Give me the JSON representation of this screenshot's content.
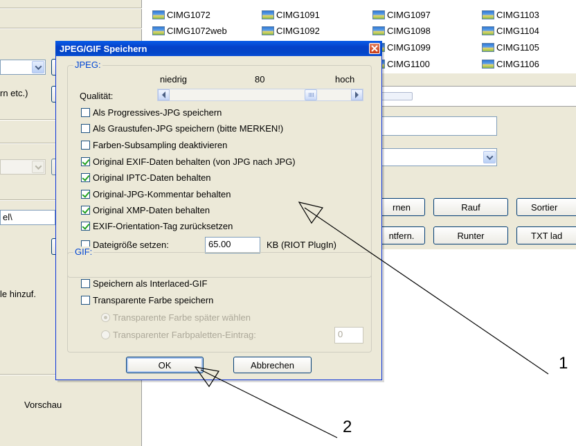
{
  "background": {
    "left_panel": {
      "label_partial_1": "rn etc.)",
      "path_partial": "el\\",
      "label_partial_2": "le hinzuf.",
      "preview_label": "Vorschau"
    },
    "files": [
      [
        "CIMG1072",
        "CIMG1091",
        "CIMG1097",
        "CIMG1103"
      ],
      [
        "CIMG1072web",
        "CIMG1092",
        "CIMG1098",
        "CIMG1104"
      ],
      [
        "",
        "",
        "CIMG1099",
        "CIMG1105"
      ],
      [
        "",
        "",
        "CIMG1100",
        "CIMG1106"
      ]
    ],
    "buttons": {
      "remove_partial": "rnen",
      "up": "Rauf",
      "sort_partial": "Sortier",
      "remove2_partial": "ntfern.",
      "down": "Runter",
      "txt_partial": "TXT lad"
    }
  },
  "dialog": {
    "title": "JPEG/GIF Speichern",
    "jpeg": {
      "legend": "JPEG:",
      "low_label": "niedrig",
      "value": "80",
      "high_label": "hoch",
      "quality_label": "Qualität:",
      "quality_fraction": 0.8,
      "options": [
        {
          "label": "Als Progressives-JPG speichern",
          "checked": false
        },
        {
          "label": "Als Graustufen-JPG speichern (bitte MERKEN!)",
          "checked": false
        },
        {
          "label": "Farben-Subsampling deaktivieren",
          "checked": false
        },
        {
          "label": "Original EXIF-Daten behalten (von JPG nach JPG)",
          "checked": true
        },
        {
          "label": "Original IPTC-Daten behalten",
          "checked": true
        },
        {
          "label": "Original-JPG-Kommentar behalten",
          "checked": true
        },
        {
          "label": "Original XMP-Daten behalten",
          "checked": true
        },
        {
          "label": "EXIF-Orientation-Tag zurücksetzen",
          "checked": true
        }
      ],
      "filesize": {
        "label": "Dateigröße setzen:",
        "checked": false,
        "value": "65.00",
        "unit": "KB (RIOT PlugIn)"
      }
    },
    "gif": {
      "legend": "GIF:",
      "interlaced_label": "Speichern als Interlaced-GIF",
      "transparent_label": "Transparente Farbe speichern",
      "radio_later": "Transparente Farbe später wählen",
      "radio_palette": "Transparenter Farbpaletten-Eintrag:",
      "palette_value": "0"
    },
    "ok_label": "OK",
    "cancel_label": "Abbrechen"
  },
  "annotations": {
    "marker_1": "1",
    "marker_2": "2"
  },
  "colors": {
    "titlebar": "#0a5de8",
    "legend": "#0046d5",
    "check": "#21a121",
    "dialog_bg": "#ece9d8"
  }
}
